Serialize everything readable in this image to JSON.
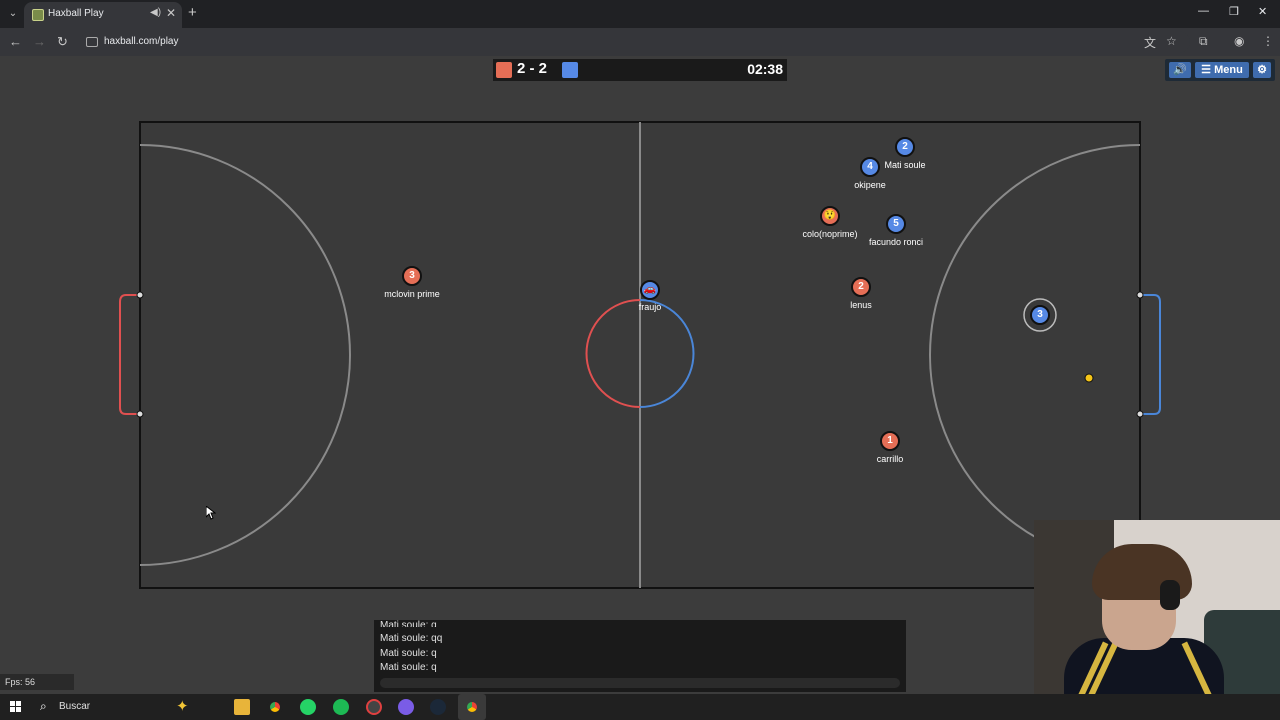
{
  "browser": {
    "tab_title": "Haxball Play",
    "url": "haxball.com/play"
  },
  "game": {
    "score": "2 - 2",
    "timer": "02:38",
    "buttons": {
      "sound": "🔊",
      "menu": "☰ Menu",
      "settings": "⚙"
    },
    "colors": {
      "red_team": "#e56e56",
      "blue_team": "#5689e5",
      "ball": "#f5c518",
      "pitch": "#3c3c3c"
    },
    "players": [
      {
        "team": "red",
        "number": "3",
        "name": "mclovin prime"
      },
      {
        "team": "blue",
        "number": "🚗",
        "name": "fraujo"
      },
      {
        "team": "blue",
        "number": "2",
        "name": "Mati soule"
      },
      {
        "team": "blue",
        "number": "4",
        "name": "okipene"
      },
      {
        "team": "red",
        "number": "😲",
        "name": "colo(noprime)"
      },
      {
        "team": "blue",
        "number": "5",
        "name": "facundo ronci"
      },
      {
        "team": "red",
        "number": "2",
        "name": "lenus"
      },
      {
        "team": "blue",
        "number": "3",
        "name": ""
      },
      {
        "team": "red",
        "number": "1",
        "name": "carrillo"
      }
    ]
  },
  "chat": {
    "lines": [
      "Mati soule: q",
      "Mati soule: qq",
      "Mati soule: q",
      "Mati soule: q"
    ]
  },
  "fps": "Fps: 56",
  "taskbar": {
    "search": "Buscar"
  }
}
